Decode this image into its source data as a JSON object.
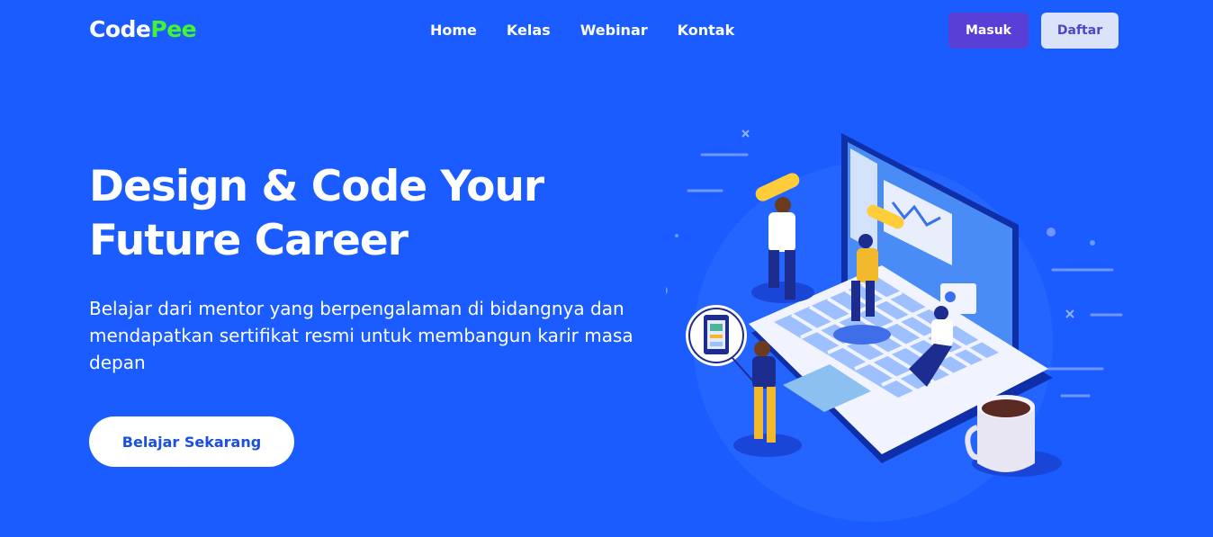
{
  "navbar": {
    "logo_part1": "Code",
    "logo_part2": "Pee",
    "links": [
      "Home",
      "Kelas",
      "Webinar",
      "Kontak"
    ],
    "login_label": "Masuk",
    "register_label": "Daftar"
  },
  "hero": {
    "title_line1": "Design & Code Your",
    "title_line2": "Future Career",
    "subtitle": "Belajar dari mentor yang berpengalaman di bidangnya dan mendapatkan sertifikat resmi untuk membangun karir masa depan",
    "cta_label": "Belajar Sekarang"
  },
  "colors": {
    "background": "#1a5cff",
    "logo_accent": "#43f42f",
    "login_button": "#5a3fd6",
    "register_button": "#dbe3fb"
  }
}
